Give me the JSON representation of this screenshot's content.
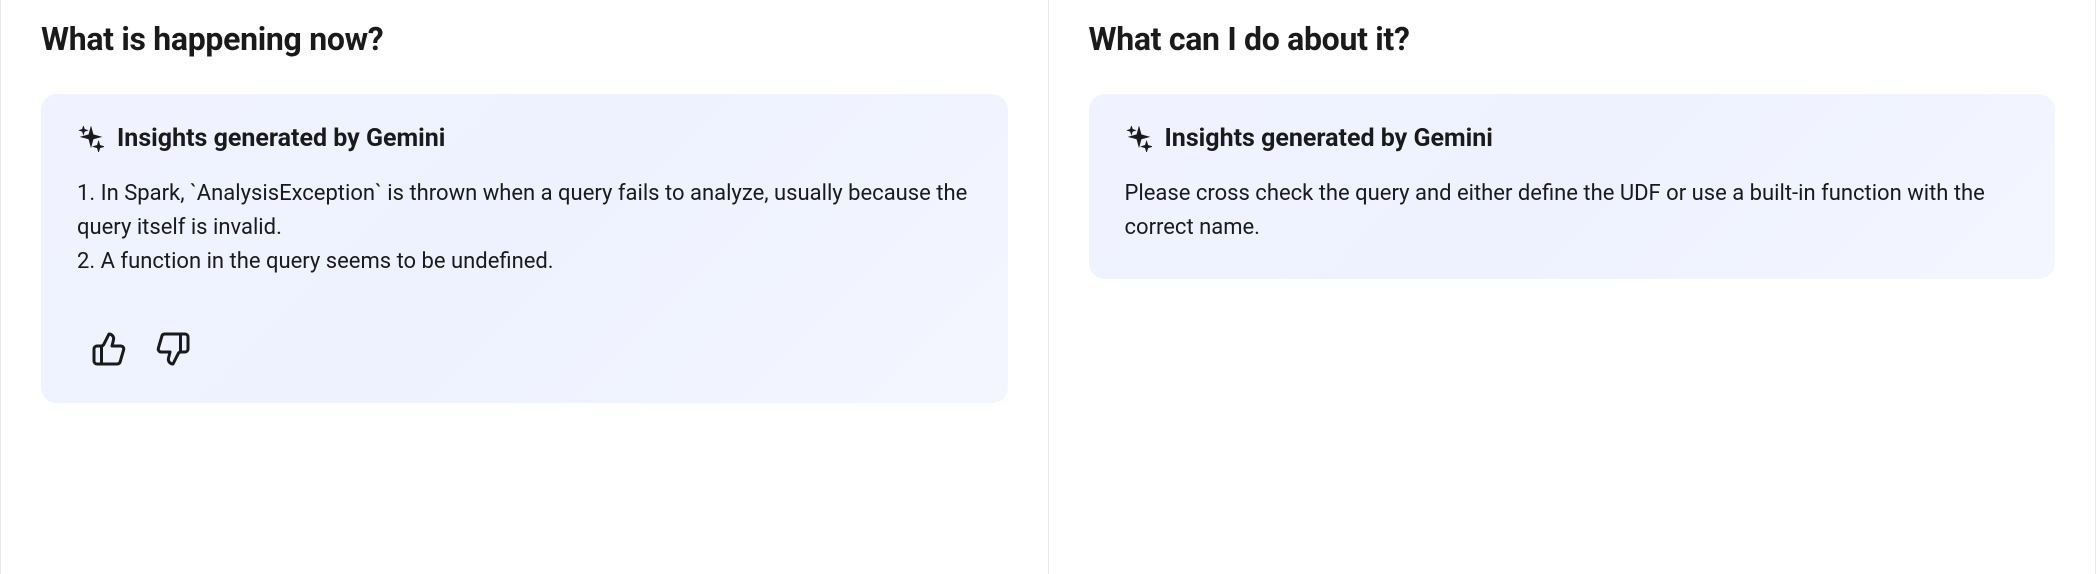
{
  "panels": {
    "left": {
      "title": "What is happening now?",
      "insight_header": "Insights generated by Gemini",
      "body_line1": "1. In Spark, `AnalysisException` is thrown when a query fails to analyze, usually because the query itself is invalid.",
      "body_line2": "2. A function in the query seems to be undefined."
    },
    "right": {
      "title": "What can I do about it?",
      "insight_header": "Insights generated by Gemini",
      "body": "Please cross check the query and either define the UDF or use a built-in function with the correct name."
    }
  }
}
